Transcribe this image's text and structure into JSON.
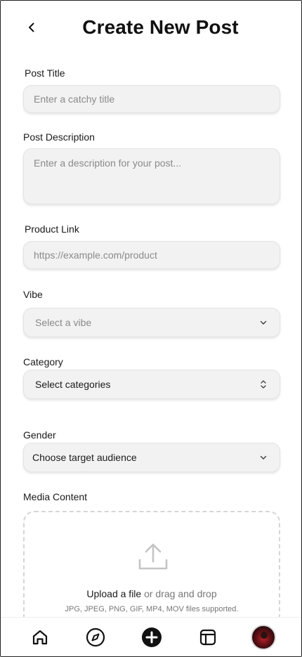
{
  "header": {
    "title": "Create New Post"
  },
  "form": {
    "post_title": {
      "label": "Post Title",
      "placeholder": "Enter a catchy title"
    },
    "post_description": {
      "label": "Post Description",
      "placeholder": "Enter a description for your post..."
    },
    "product_link": {
      "label": "Product Link",
      "placeholder": "https://example.com/product"
    },
    "vibe": {
      "label": "Vibe",
      "value": "Select a vibe"
    },
    "category": {
      "label": "Category",
      "value": "Select categories"
    },
    "gender": {
      "label": "Gender",
      "value": "Choose target audience"
    },
    "media": {
      "label": "Media Content",
      "upload_link": "Upload a file",
      "upload_rest": " or drag and drop",
      "hint": "JPG, JPEG, PNG, GIF, MP4, MOV files supported."
    }
  },
  "tabbar": {
    "icons": [
      "home-icon",
      "compass-icon",
      "add-circle-icon",
      "layout-icon",
      "avatar"
    ]
  }
}
